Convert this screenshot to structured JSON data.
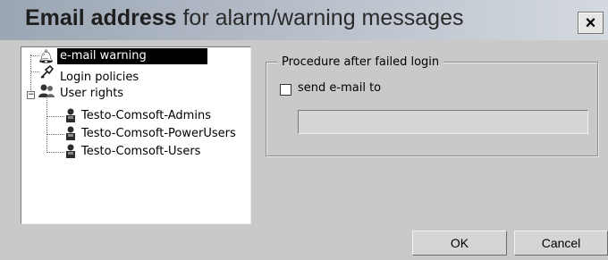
{
  "dialog": {
    "title_bold": "Email address",
    "title_rest": " for alarm/warning messages",
    "close_label": "×"
  },
  "tree": {
    "items": [
      {
        "label": "e-mail warning",
        "icon": "bell-icon",
        "selected": true
      },
      {
        "label": "Login policies",
        "icon": "key-pen-icon",
        "selected": false
      },
      {
        "label": "User rights",
        "icon": "users-group-icon",
        "selected": false,
        "expanded": true,
        "children": [
          {
            "label": "Testo-Comsoft-Admins",
            "icon": "user-icon"
          },
          {
            "label": "Testo-Comsoft-PowerUsers",
            "icon": "user-icon"
          },
          {
            "label": "Testo-Comsoft-Users",
            "icon": "user-icon"
          }
        ]
      }
    ],
    "expander_symbol": "−"
  },
  "panel": {
    "group_title": "Procedure after failed login",
    "checkbox_label": "send e-mail to",
    "checkbox_checked": false,
    "email_value": ""
  },
  "buttons": {
    "ok": "OK",
    "cancel": "Cancel"
  },
  "colors": {
    "dialog_bg": "#c9c9c9",
    "selection_bg": "#000000",
    "selection_fg": "#ffffff"
  }
}
